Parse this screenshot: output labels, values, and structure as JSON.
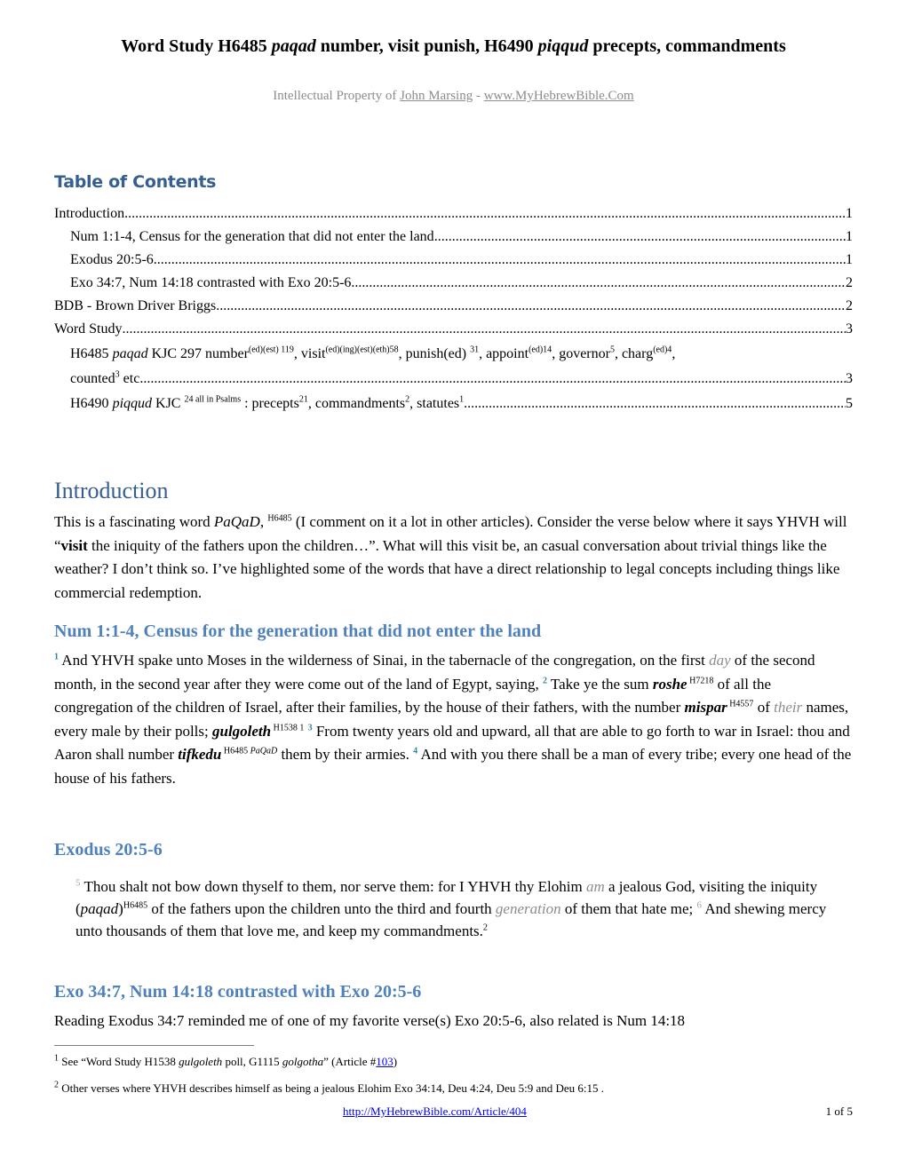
{
  "header": {
    "title_a": "Word Study H6485 ",
    "title_b": "paqad",
    "title_c": " number, visit punish, H6490 ",
    "title_d": "piqqud",
    "title_e": " precepts, commandments",
    "subtitle_prefix": "Intellectual Property of ",
    "author_link": "John Marsing",
    "subtitle_sep": " - ",
    "site_link": "www.MyHebrewBible.Com"
  },
  "toc": {
    "heading": "Table of Contents",
    "entries": [
      {
        "text": "Introduction",
        "page": "1"
      },
      {
        "text": "Num 1:1-4, Census for the generation that did not enter the land",
        "page": "1"
      },
      {
        "text": "Exodus 20:5-6",
        "page": "1"
      },
      {
        "text": "Exo 34:7, Num 14:18 contrasted with Exo 20:5-6",
        "page": "2"
      },
      {
        "text": "BDB -  Brown Driver Briggs",
        "page": "2"
      },
      {
        "text": "Word Study",
        "page": "3"
      },
      {
        "text": "counted",
        "page": "3"
      },
      {
        "text": "precepts",
        "page": "5"
      }
    ],
    "entry6": {
      "a": "H6485 ",
      "b": "paqad",
      "c": " KJC 297 number",
      "s1": "(ed)(est)  119",
      "d": ", visit",
      "s2": "(ed)(ing)(est)(eth)58",
      "e": ", punish(ed) ",
      "s3": "31",
      "f": ", appoint",
      "s4": "(ed)14",
      "g": ", governor",
      "s5": "5",
      "h": ", charg",
      "s6": "(ed)4",
      "i": ",",
      "line2": "counted",
      "s7": "3",
      "line2b": " etc",
      "page": "3"
    },
    "entry7": {
      "a": "H6490 ",
      "b": "piqqud",
      "c": " KJC ",
      "s1": "24 all in Psalms",
      "d": " : precepts",
      "s2": "21",
      "e": ", commandments",
      "s3": "2",
      "f": ", statutes",
      "s4": "1",
      "page": "5"
    }
  },
  "intro": {
    "heading": "Introduction",
    "p_a": "This is a fascinating word ",
    "p_b": "PaQaD",
    "p_c": ", ",
    "p_sup": "H6485",
    "p_d": " (I comment on it a lot in other articles). Consider the verse below where it says YHVH will “",
    "p_bold": "visit",
    "p_e": " the iniquity of the fathers upon the children…”.  What will this visit be, an casual conversation about trivial things like the weather?  I don’t think so.  I’ve highlighted some of the words that have a direct relationship to legal concepts including things like commercial redemption."
  },
  "num": {
    "heading": "Num 1:1-4, Census for the generation that did not enter the land",
    "v1": "1",
    "t1": " And YHVH spake unto Moses in the wilderness of Sinai, in the tabernacle of the congregation, on the first ",
    "g1": "day",
    "t2": " of the second month, in the second year after they were come out of the land of Egypt, saying,  ",
    "v2": "2",
    "t3": " Take ye the sum ",
    "b1": "roshe",
    "s1": " H7218",
    "t4": " of all the congregation of the children of Israel, after their families, by the house of their fathers, with the number ",
    "b2": "mispar",
    "s2": " H4557",
    "t5": " of ",
    "g2": "their",
    "t6": " names, every male by their polls; ",
    "b3": "gulgoleth",
    "s3": " H1538  1",
    "t7": "  ",
    "v3": "3",
    "t8": " From twenty years old and upward, all that are able to go forth to war in Israel: thou and Aaron shall number ",
    "b4": "tifkedu",
    "s4": " H6485 ",
    "s4i": "PaQaD",
    "t9": " them by their armies.  ",
    "v4": "4",
    "t10": " And with you there shall be a man of every tribe; every one head of the house of his fathers."
  },
  "exodus": {
    "heading": "Exodus 20:5-6",
    "v5": "5",
    "t1": " Thou shalt not bow down thyself to them, nor serve them: for I YHVH thy Elohim ",
    "g1": "am",
    "t2": " a jealous God, visiting  the iniquity (",
    "i1": "paqad",
    "t3": ")",
    "s1": "H6485",
    "t4": " of the fathers upon the children unto the third and fourth ",
    "g2": "generation",
    "t5": " of them that hate   me; ",
    "v6": "6",
    "t6": " And shewing mercy unto thousands of them that love me, and keep my commandments.",
    "fn": "2"
  },
  "exo34": {
    "heading": "Exo 34:7, Num 14:18 contrasted with Exo 20:5-6",
    "text": "Reading Exodus 34:7 reminded me of one of my favorite verse(s) Exo 20:5-6, also related is Num 14:18"
  },
  "footnotes": [
    {
      "num": "1",
      "a": " See “Word Study H1538 ",
      "i1": "gulgoleth",
      "b": " poll, G1115 ",
      "i2": "golgotha",
      "c": "” (Article #",
      "link": "103",
      "d": ")"
    },
    {
      "num": "2",
      "text": " Other verses where YHVH describes himself as being a jealous Elohim Exo 34:14, Deu 4:24, Deu 5:9 and Deu 6:15 ."
    }
  ],
  "footer": {
    "link": "http://MyHebrewBible.com/Article/404",
    "page": "1 of 5"
  }
}
